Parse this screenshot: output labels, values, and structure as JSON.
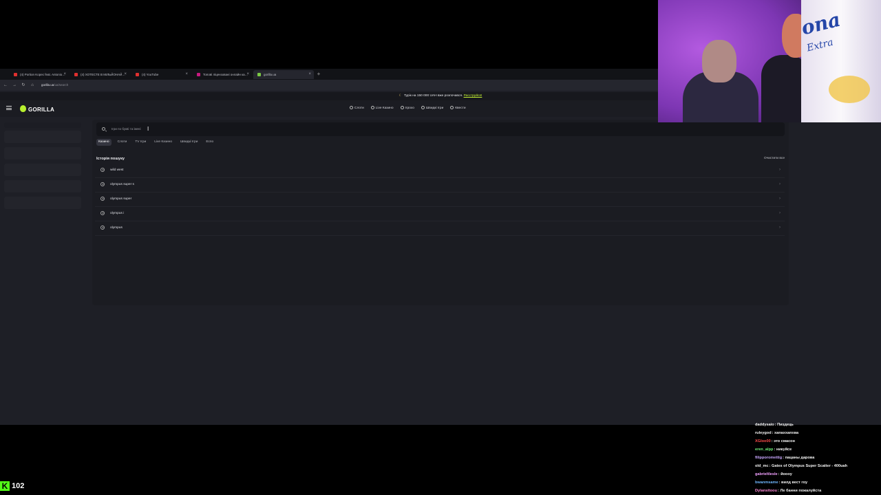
{
  "browser": {
    "tabs": [
      {
        "label": "(4) Portion Kopec feat. Antonio…",
        "fav": "#e0302f"
      },
      {
        "label": "(4) ХОТЕСТЕ В МІЛЬЙОНАЙ…",
        "fav": "#e0302f"
      },
      {
        "label": "(4) YouTube",
        "fav": "#e0302f"
      },
      {
        "label": "Топові ліцензовані онлайн ка…",
        "fav": "#c7197f"
      },
      {
        "label": "gorilla.ua",
        "fav": "#7ac943"
      }
    ],
    "new_tab": "+",
    "url_host": "gorilla.ua",
    "url_path": "/ua/search"
  },
  "promo": {
    "text": "Турік на 150 000 UAH вже розпочався.",
    "link": "Реєструйся!"
  },
  "site": {
    "logo": "GORILLA",
    "nav": [
      "Слоти",
      "Live Казино",
      "Ігрохо",
      "Швидкі Ігри",
      "Квести"
    ]
  },
  "search": {
    "placeholder": "Ігри по букві та імені"
  },
  "categories": [
    "Казино",
    "Слоти",
    "TV Ігри",
    "Live Казино",
    "Швидкі Ігри",
    "Еспо"
  ],
  "history": {
    "title": "Історія пошуку",
    "clear_label": "Очистити все",
    "items": [
      "wild west",
      "olympus super s",
      "olympus super",
      "olympus i",
      "olympus"
    ]
  },
  "chat": [
    {
      "user": "daddysaio",
      "text": "Пиздець",
      "color": "#f4f4f4"
    },
    {
      "user": "ruleygod",
      "text": "хапаххапхва",
      "color": "#f4f4f4"
    },
    {
      "user": "XGloo00",
      "text": "это смасон",
      "color": "#ff4b4b"
    },
    {
      "user": "eren_alpp",
      "text": "никуйсе",
      "color": "#6ff07a"
    },
    {
      "user": "filipporomettig",
      "text": "пацаны дарова",
      "color": "#c9a7ff"
    },
    {
      "user": "old_mc",
      "text": "Gates of Olympus Super Scatter - 400uah",
      "color": "#f4f4f4"
    },
    {
      "user": "gabrieltlesle",
      "text": "йоооу",
      "color": "#f2a1ff"
    },
    {
      "user": "bwanmsame",
      "text": "вилд вест гоу",
      "color": "#71b8ff"
    },
    {
      "user": "Dylansitoou",
      "text": "Ле банни пожалуйста",
      "color": "#ff8ad6"
    }
  ],
  "viewers": {
    "platform_icon": "K",
    "count": "102"
  }
}
